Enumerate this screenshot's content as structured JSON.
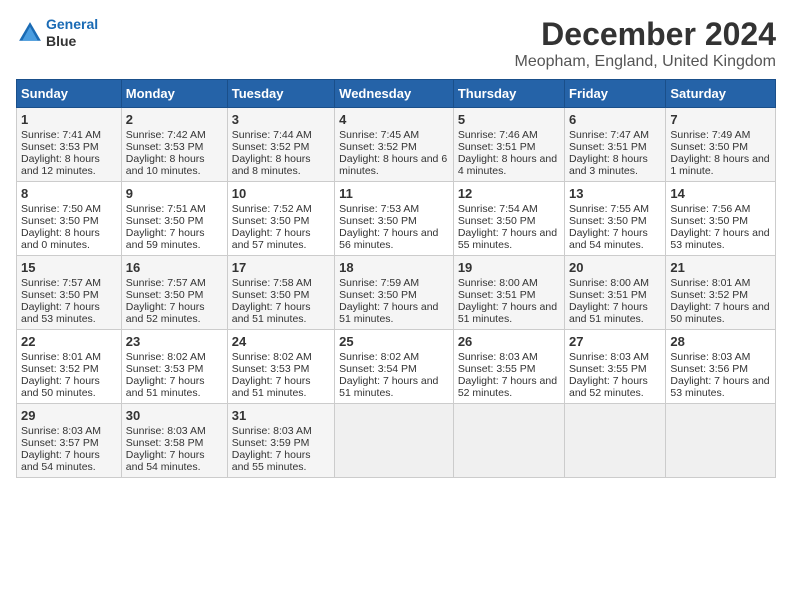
{
  "header": {
    "logo_line1": "General",
    "logo_line2": "Blue",
    "title": "December 2024",
    "subtitle": "Meopham, England, United Kingdom"
  },
  "columns": [
    "Sunday",
    "Monday",
    "Tuesday",
    "Wednesday",
    "Thursday",
    "Friday",
    "Saturday"
  ],
  "weeks": [
    [
      {
        "day": "1",
        "sunrise": "Sunrise: 7:41 AM",
        "sunset": "Sunset: 3:53 PM",
        "daylight": "Daylight: 8 hours and 12 minutes."
      },
      {
        "day": "2",
        "sunrise": "Sunrise: 7:42 AM",
        "sunset": "Sunset: 3:53 PM",
        "daylight": "Daylight: 8 hours and 10 minutes."
      },
      {
        "day": "3",
        "sunrise": "Sunrise: 7:44 AM",
        "sunset": "Sunset: 3:52 PM",
        "daylight": "Daylight: 8 hours and 8 minutes."
      },
      {
        "day": "4",
        "sunrise": "Sunrise: 7:45 AM",
        "sunset": "Sunset: 3:52 PM",
        "daylight": "Daylight: 8 hours and 6 minutes."
      },
      {
        "day": "5",
        "sunrise": "Sunrise: 7:46 AM",
        "sunset": "Sunset: 3:51 PM",
        "daylight": "Daylight: 8 hours and 4 minutes."
      },
      {
        "day": "6",
        "sunrise": "Sunrise: 7:47 AM",
        "sunset": "Sunset: 3:51 PM",
        "daylight": "Daylight: 8 hours and 3 minutes."
      },
      {
        "day": "7",
        "sunrise": "Sunrise: 7:49 AM",
        "sunset": "Sunset: 3:50 PM",
        "daylight": "Daylight: 8 hours and 1 minute."
      }
    ],
    [
      {
        "day": "8",
        "sunrise": "Sunrise: 7:50 AM",
        "sunset": "Sunset: 3:50 PM",
        "daylight": "Daylight: 8 hours and 0 minutes."
      },
      {
        "day": "9",
        "sunrise": "Sunrise: 7:51 AM",
        "sunset": "Sunset: 3:50 PM",
        "daylight": "Daylight: 7 hours and 59 minutes."
      },
      {
        "day": "10",
        "sunrise": "Sunrise: 7:52 AM",
        "sunset": "Sunset: 3:50 PM",
        "daylight": "Daylight: 7 hours and 57 minutes."
      },
      {
        "day": "11",
        "sunrise": "Sunrise: 7:53 AM",
        "sunset": "Sunset: 3:50 PM",
        "daylight": "Daylight: 7 hours and 56 minutes."
      },
      {
        "day": "12",
        "sunrise": "Sunrise: 7:54 AM",
        "sunset": "Sunset: 3:50 PM",
        "daylight": "Daylight: 7 hours and 55 minutes."
      },
      {
        "day": "13",
        "sunrise": "Sunrise: 7:55 AM",
        "sunset": "Sunset: 3:50 PM",
        "daylight": "Daylight: 7 hours and 54 minutes."
      },
      {
        "day": "14",
        "sunrise": "Sunrise: 7:56 AM",
        "sunset": "Sunset: 3:50 PM",
        "daylight": "Daylight: 7 hours and 53 minutes."
      }
    ],
    [
      {
        "day": "15",
        "sunrise": "Sunrise: 7:57 AM",
        "sunset": "Sunset: 3:50 PM",
        "daylight": "Daylight: 7 hours and 53 minutes."
      },
      {
        "day": "16",
        "sunrise": "Sunrise: 7:57 AM",
        "sunset": "Sunset: 3:50 PM",
        "daylight": "Daylight: 7 hours and 52 minutes."
      },
      {
        "day": "17",
        "sunrise": "Sunrise: 7:58 AM",
        "sunset": "Sunset: 3:50 PM",
        "daylight": "Daylight: 7 hours and 51 minutes."
      },
      {
        "day": "18",
        "sunrise": "Sunrise: 7:59 AM",
        "sunset": "Sunset: 3:50 PM",
        "daylight": "Daylight: 7 hours and 51 minutes."
      },
      {
        "day": "19",
        "sunrise": "Sunrise: 8:00 AM",
        "sunset": "Sunset: 3:51 PM",
        "daylight": "Daylight: 7 hours and 51 minutes."
      },
      {
        "day": "20",
        "sunrise": "Sunrise: 8:00 AM",
        "sunset": "Sunset: 3:51 PM",
        "daylight": "Daylight: 7 hours and 51 minutes."
      },
      {
        "day": "21",
        "sunrise": "Sunrise: 8:01 AM",
        "sunset": "Sunset: 3:52 PM",
        "daylight": "Daylight: 7 hours and 50 minutes."
      }
    ],
    [
      {
        "day": "22",
        "sunrise": "Sunrise: 8:01 AM",
        "sunset": "Sunset: 3:52 PM",
        "daylight": "Daylight: 7 hours and 50 minutes."
      },
      {
        "day": "23",
        "sunrise": "Sunrise: 8:02 AM",
        "sunset": "Sunset: 3:53 PM",
        "daylight": "Daylight: 7 hours and 51 minutes."
      },
      {
        "day": "24",
        "sunrise": "Sunrise: 8:02 AM",
        "sunset": "Sunset: 3:53 PM",
        "daylight": "Daylight: 7 hours and 51 minutes."
      },
      {
        "day": "25",
        "sunrise": "Sunrise: 8:02 AM",
        "sunset": "Sunset: 3:54 PM",
        "daylight": "Daylight: 7 hours and 51 minutes."
      },
      {
        "day": "26",
        "sunrise": "Sunrise: 8:03 AM",
        "sunset": "Sunset: 3:55 PM",
        "daylight": "Daylight: 7 hours and 52 minutes."
      },
      {
        "day": "27",
        "sunrise": "Sunrise: 8:03 AM",
        "sunset": "Sunset: 3:55 PM",
        "daylight": "Daylight: 7 hours and 52 minutes."
      },
      {
        "day": "28",
        "sunrise": "Sunrise: 8:03 AM",
        "sunset": "Sunset: 3:56 PM",
        "daylight": "Daylight: 7 hours and 53 minutes."
      }
    ],
    [
      {
        "day": "29",
        "sunrise": "Sunrise: 8:03 AM",
        "sunset": "Sunset: 3:57 PM",
        "daylight": "Daylight: 7 hours and 54 minutes."
      },
      {
        "day": "30",
        "sunrise": "Sunrise: 8:03 AM",
        "sunset": "Sunset: 3:58 PM",
        "daylight": "Daylight: 7 hours and 54 minutes."
      },
      {
        "day": "31",
        "sunrise": "Sunrise: 8:03 AM",
        "sunset": "Sunset: 3:59 PM",
        "daylight": "Daylight: 7 hours and 55 minutes."
      },
      null,
      null,
      null,
      null
    ]
  ]
}
